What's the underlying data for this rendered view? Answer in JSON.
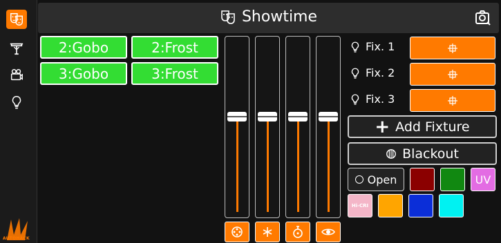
{
  "header": {
    "title": "Showtime",
    "icon": "theater-masks-icon",
    "right_icon": "camera-face-icon"
  },
  "sidebar": {
    "items": [
      {
        "name": "scenes",
        "icon": "theater-masks-icon",
        "active": true
      },
      {
        "name": "stage",
        "icon": "truss-icon",
        "active": false
      },
      {
        "name": "movie",
        "icon": "movie-camera-icon",
        "active": false
      },
      {
        "name": "fixtures",
        "icon": "lightbulb-icon",
        "active": false
      }
    ],
    "logo_text": "AUTOHACK"
  },
  "scenes": [
    {
      "label": "2:Gobo"
    },
    {
      "label": "2:Frost"
    },
    {
      "label": "3:Gobo"
    },
    {
      "label": "3:Frost"
    }
  ],
  "faders": [
    {
      "level": 0.56,
      "button_icon": "gobo-wheel-icon"
    },
    {
      "level": 0.56,
      "button_icon": "frost-icon"
    },
    {
      "level": 0.56,
      "button_icon": "focus-icon"
    },
    {
      "level": 0.56,
      "button_icon": "eye-icon"
    }
  ],
  "fixtures": [
    {
      "label": "Fix. 1",
      "icon": "bulb-icon",
      "button_icon": "crosshair-icon"
    },
    {
      "label": "Fix. 2",
      "icon": "bulb-icon",
      "button_icon": "crosshair-icon"
    },
    {
      "label": "Fix. 3",
      "icon": "bulb-icon",
      "button_icon": "crosshair-icon"
    }
  ],
  "actions": {
    "add_fixture": "Add Fixture",
    "blackout": "Blackout"
  },
  "colors": {
    "open_label": "Open",
    "uv_label": "UV",
    "hicri_label": "Hi-CRI",
    "red": "#8b0000",
    "green": "#118811",
    "uv": "#e36ce3",
    "hicri": "#f4b6c8",
    "amber": "#ffa500",
    "blue": "#0b2ed8",
    "cyan": "#00f2f2"
  },
  "accent": "#ff7a00",
  "scene_color": "#33dd33"
}
